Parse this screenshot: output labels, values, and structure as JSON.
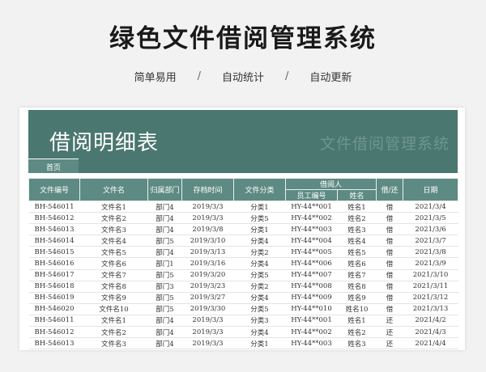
{
  "hero": {
    "title": "绿色文件借阅管理系统",
    "features": [
      "简单易用",
      "自动统计",
      "自动更新"
    ],
    "separator": "/"
  },
  "sheet": {
    "banner_title": "借阅明细表",
    "banner_watermark": "文件借阅管理系统",
    "home_tab": "首页",
    "colors": {
      "banner": "#4a7770",
      "header": "#5d8a83"
    },
    "headers": {
      "file_no": "文件编号",
      "file_name": "文件名",
      "department": "归属部门",
      "archive_time": "存档时间",
      "category": "文件分类",
      "borrower_group": "借阅人",
      "employee_no": "员工编号",
      "name": "姓名",
      "borrow_return": "借/还",
      "date": "日期"
    },
    "rows": [
      [
        "BH-546011",
        "文件名1",
        "部门4",
        "2019/3/3",
        "分类1",
        "HY-44**001",
        "姓名1",
        "借",
        "2021/3/4"
      ],
      [
        "BH-546012",
        "文件名2",
        "部门4",
        "2019/3/3",
        "分类5",
        "HY-44**002",
        "姓名2",
        "借",
        "2021/3/5"
      ],
      [
        "BH-546013",
        "文件名3",
        "部门4",
        "2019/3/8",
        "分类1",
        "HY-44**003",
        "姓名3",
        "借",
        "2021/3/6"
      ],
      [
        "BH-546014",
        "文件名4",
        "部门5",
        "2019/3/10",
        "分类4",
        "HY-44**004",
        "姓名4",
        "借",
        "2021/3/7"
      ],
      [
        "BH-546015",
        "文件名5",
        "部门4",
        "2019/3/13",
        "分类2",
        "HY-44**005",
        "姓名5",
        "借",
        "2021/3/8"
      ],
      [
        "BH-546016",
        "文件名6",
        "部门1",
        "2019/3/16",
        "分类4",
        "HY-44**006",
        "姓名6",
        "借",
        "2021/3/9"
      ],
      [
        "BH-546017",
        "文件名7",
        "部门5",
        "2019/3/20",
        "分类5",
        "HY-44**007",
        "姓名7",
        "借",
        "2021/3/10"
      ],
      [
        "BH-546018",
        "文件名8",
        "部门3",
        "2019/3/23",
        "分类2",
        "HY-44**008",
        "姓名8",
        "借",
        "2021/3/11"
      ],
      [
        "BH-546019",
        "文件名9",
        "部门5",
        "2019/3/27",
        "分类4",
        "HY-44**009",
        "姓名9",
        "借",
        "2021/3/12"
      ],
      [
        "BH-546020",
        "文件名10",
        "部门5",
        "2019/3/30",
        "分类5",
        "HY-44**010",
        "姓名10",
        "借",
        "2021/3/13"
      ],
      [
        "BH-546011",
        "文件名1",
        "部门4",
        "2019/3/3",
        "分类3",
        "HY-44**001",
        "姓名1",
        "还",
        "2021/4/2"
      ],
      [
        "BH-546012",
        "文件名2",
        "部门4",
        "2019/3/3",
        "分类4",
        "HY-44**002",
        "姓名2",
        "还",
        "2021/4/3"
      ],
      [
        "BH-546013",
        "文件名3",
        "部门4",
        "2019/3/3",
        "分类1",
        "HY-44**003",
        "姓名3",
        "还",
        "2021/4/4"
      ]
    ]
  }
}
